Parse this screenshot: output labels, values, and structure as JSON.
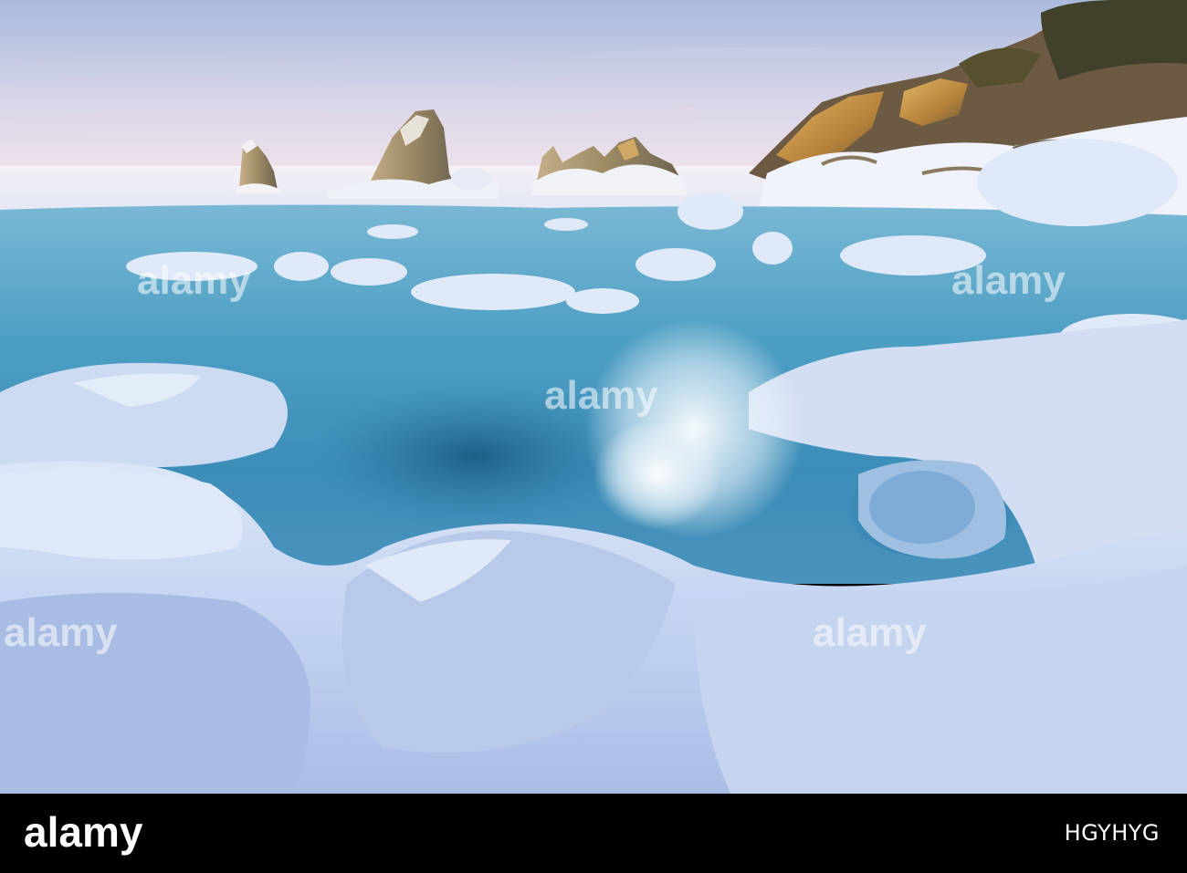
{
  "photo": {
    "subject": "frozen-sea-coast",
    "colors": {
      "sky_top": "#b5c3df",
      "sky_horizon": "#eadfe8",
      "water": "#3f9cc0",
      "ice": "#c9daf4",
      "sunlit_rock": "#d4a04c"
    }
  },
  "watermark": {
    "text": "alamy"
  },
  "footer": {
    "brand": "alamy",
    "image_id": "HGYHYG"
  }
}
